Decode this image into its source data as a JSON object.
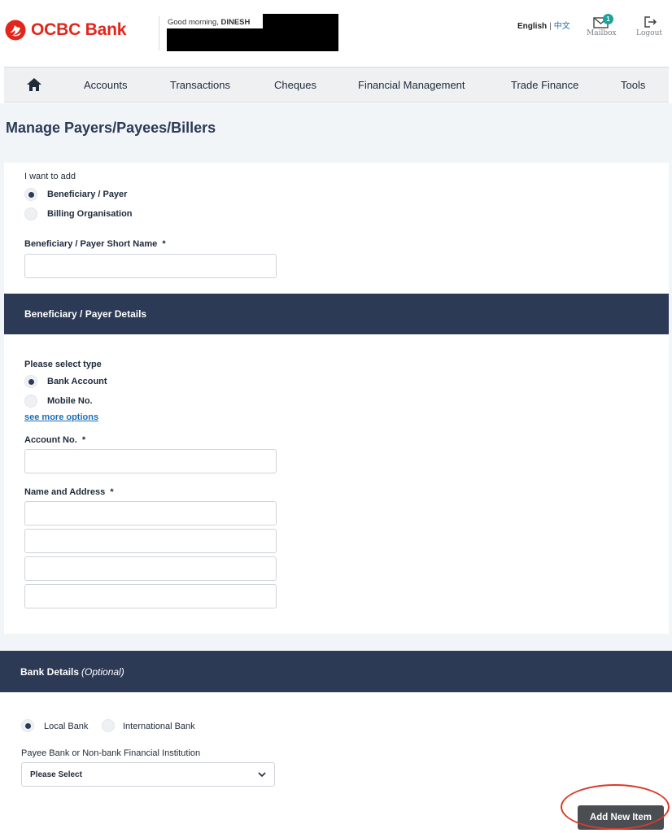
{
  "brand": {
    "name": "OCBC Bank",
    "color": "#e2261c",
    "logo_icon": "ocbc-logo-icon"
  },
  "header": {
    "greeting_prefix": "Good morning, ",
    "user_name": "DINESH",
    "lang_current": "English",
    "lang_separator": "|",
    "lang_alt": "中文",
    "mailbox_label": "Mailbox",
    "mailbox_count": "1",
    "logout_label": "Logout"
  },
  "nav": {
    "home_icon": "home-icon",
    "items": [
      "Accounts",
      "Transactions",
      "Cheques",
      "Financial Management",
      "Trade Finance",
      "Tools"
    ]
  },
  "page": {
    "title": "Manage Payers/Payees/Billers"
  },
  "add_section": {
    "prompt": "I want to add",
    "options": [
      "Beneficiary / Payer",
      "Billing Organisation"
    ],
    "selected": "Beneficiary / Payer",
    "short_name_label": "Beneficiary / Payer Short Name",
    "required_mark": "*",
    "short_name_value": ""
  },
  "details_section": {
    "title": "Beneficiary / Payer Details",
    "type_prompt": "Please select type",
    "type_options": [
      "Bank Account",
      "Mobile No."
    ],
    "type_selected": "Bank Account",
    "see_more": "see more options",
    "account_label": "Account No.",
    "account_value": "",
    "name_address_label": "Name and Address",
    "name_address_lines": [
      "",
      "",
      "",
      ""
    ]
  },
  "bank_section": {
    "title": "Bank Details",
    "title_suffix": "(Optional)",
    "bank_options": [
      "Local Bank",
      "International Bank"
    ],
    "bank_selected": "Local Bank",
    "institution_label": "Payee Bank or Non-bank Financial Institution",
    "institution_selected": "Please Select"
  },
  "actions": {
    "add_new_item": "Add New Item",
    "highlight_color": "#d83a2a"
  },
  "colors": {
    "navy": "#2c3a56",
    "link": "#1a6fb5",
    "badge": "#1aa39a",
    "button": "#4a4d52"
  }
}
